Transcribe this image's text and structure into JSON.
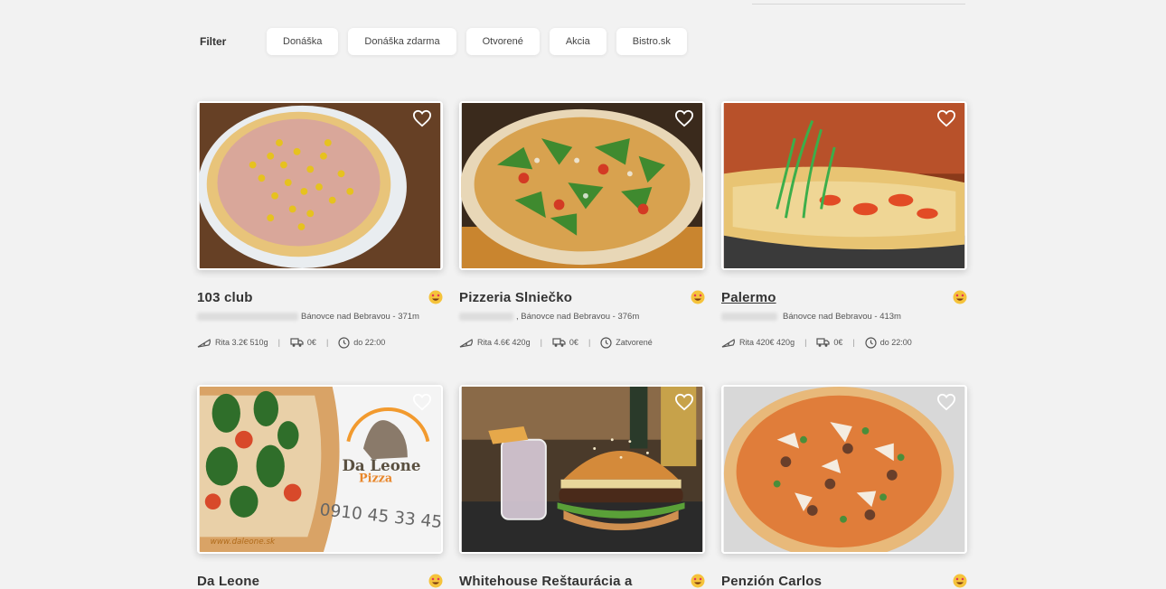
{
  "filter": {
    "label": "Filter",
    "chips": [
      "Donáška",
      "Donáška zdarma",
      "Otvorené",
      "Akcia",
      "Bistro.sk"
    ]
  },
  "restaurants": [
    {
      "name": "103 club",
      "address": "Bánovce nad Bebravou - 371m",
      "dish": "Rita 3.2€",
      "weight": "510g",
      "delivery": "0€",
      "hours": "do 22:00"
    },
    {
      "name": "Pizzeria Slniečko",
      "address": ", Bánovce nad Bebravou - 376m",
      "dish": "Rita 4.6€",
      "weight": "420g",
      "delivery": "0€",
      "hours": "Zatvorené"
    },
    {
      "name": "Palermo",
      "address": "Bánovce nad Bebravou - 413m",
      "dish": "Rita 420€",
      "weight": "420g",
      "delivery": "0€",
      "hours": "do 22:00"
    },
    {
      "name": "Da Leone",
      "logo_text": "Da Leone",
      "logo_sub": "Pizza",
      "phone": "0910 45 33 45",
      "url": "www.daleone.sk"
    },
    {
      "name": "Whitehouse Reštaurácia a"
    },
    {
      "name": "Penzión Carlos"
    }
  ],
  "colors": {
    "background": "#f2f2f2",
    "card_border": "#ffffff",
    "text": "#333333"
  }
}
